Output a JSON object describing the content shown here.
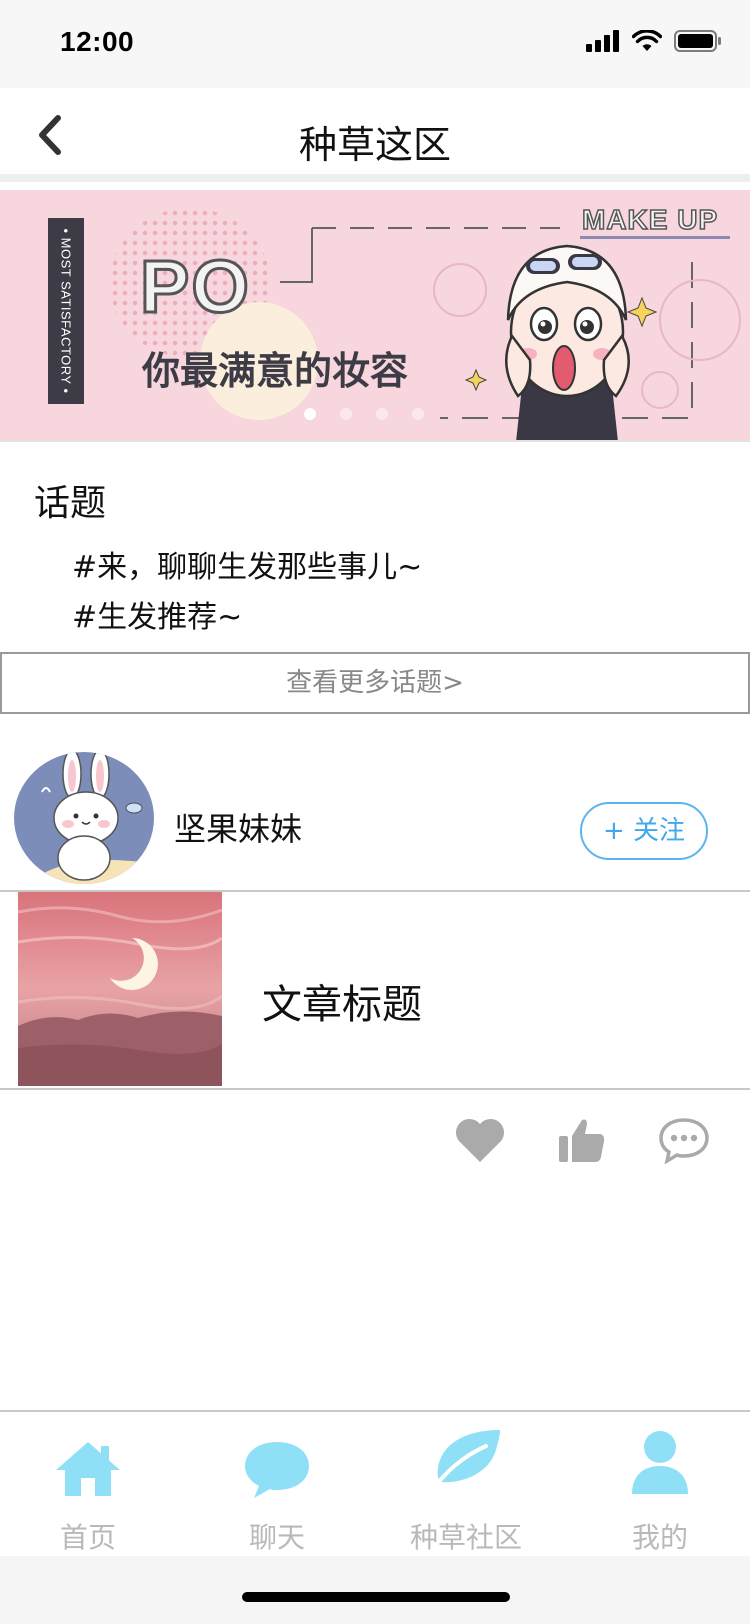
{
  "status_bar": {
    "time": "12:00"
  },
  "nav": {
    "title": "种草这区"
  },
  "banner": {
    "side_text": "• MOST SATISFACTORY •",
    "big_text": "PO",
    "slogan": "你最满意的妆容",
    "corner_text": "MAKE UP",
    "page_count": 4,
    "active_page": 1
  },
  "topics": {
    "heading": "话题",
    "items": [
      "#来，聊聊生发那些事儿~",
      "#生发推荐~"
    ],
    "more_label": "查看更多话题>"
  },
  "author": {
    "name": "坚果妹妹",
    "follow_label": "+ 关注"
  },
  "article": {
    "title": "文章标题"
  },
  "tab_bar": {
    "items": [
      {
        "label": "首页",
        "icon": "home-icon"
      },
      {
        "label": "聊天",
        "icon": "chat-bubble-icon"
      },
      {
        "label": "种草社区",
        "icon": "leaf-icon"
      },
      {
        "label": "我的",
        "icon": "person-icon"
      }
    ]
  },
  "colors": {
    "accent": "#41a8ec",
    "tab_icon": "#8fe0f6",
    "tab_label": "#b9b9b9",
    "banner_bg": "#f7d6de",
    "action_icon": "#aaaaaa"
  }
}
